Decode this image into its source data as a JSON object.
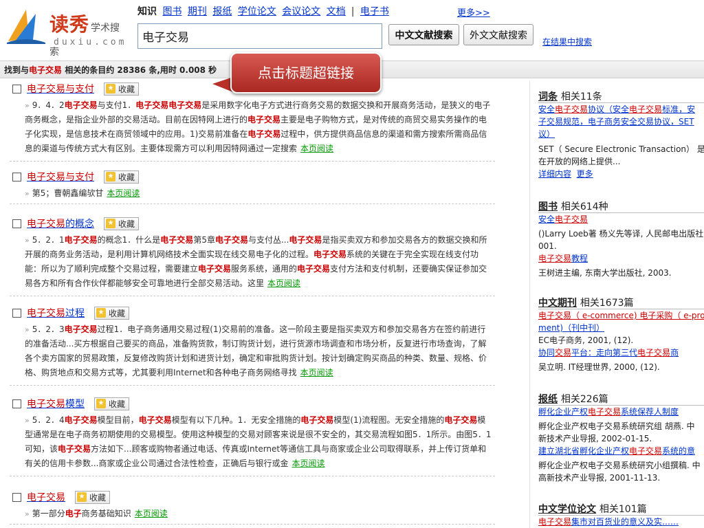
{
  "header": {
    "logo": {
      "brand_cn": "读秀",
      "brand_sub": "学术搜索",
      "brand_en": "duxiu.com"
    },
    "nav": {
      "lead": "知识",
      "items": [
        "图书",
        "期刊",
        "报纸",
        "学位论文",
        "会议论文",
        "文档"
      ],
      "sep": "|",
      "last": "电子书",
      "more": "更多>>"
    },
    "search": {
      "value": "电子交易",
      "btn_cn": "中文文献搜索",
      "btn_foreign": "外文文献搜索",
      "in_results": "在结果中搜索"
    }
  },
  "result_bar": {
    "pre": "找到与",
    "keyword": "电子交易",
    "mid": " 相关的条目约 28386 条,用时 0.008 秒"
  },
  "callout": {
    "text": "点击标题超链接"
  },
  "fav_label": "收藏",
  "read_label": "本页阅读",
  "results": [
    {
      "title_hl": "电子交易与支付",
      "title_rest": "",
      "snippet_html": "9．4．2<b class=\"hl\">电子交易</b>与支付1．<b class=\"hl\">电子交易电子交易</b>是采用数字化电子方式进行商务交易的数据交换和开展商务活动，是狭义的电子商务概念，是指企业外部的交易活动。目前在因特网上进行的<b class=\"hl\">电子交易</b>主要是电子购物方式，是对传统的商贸交易实务操作的电子化实现，是信息技术在商贸领域中的应用。1)交易前准备在<b class=\"hl\">电子交易</b>过程中，供方提供商品信息的渠道和需方搜索所需商品信息的渠道与传统方式大有区别。主要体现需方可以利用因特网通过一定搜索"
    },
    {
      "title_hl": "电子交易与支付",
      "title_rest": "",
      "snippet_html": "第5；曹朝鑫编欤甘"
    },
    {
      "title_hl": "电子交易",
      "title_rest": "的概念",
      "snippet_html": "5．2．1<b class=\"hl\">电子交易</b>的概念1．什么是<b class=\"hl\">电子交易</b>第5章<b class=\"hl\">电子交易</b>与支付丛...<b class=\"hl\">电子交易</b>是指买卖双方和参加交易各方的数据交换和所开展的商务业务活动，是利用计算机网络技术全面实现在线交易电子化的过程。<b class=\"hl\">电子交易</b>系统的关键在于完全实现在线支付功能：所以为了顺利完成整个交易过程，需要建立<b class=\"hl\">电子交易</b>服务系统，通用的<b class=\"hl\">电子交易</b>支付方法和支付机制，还要确实保证参加交易各方和所有合作伙伴都能够安全可靠地进行全部交易活动。这里"
    },
    {
      "title_hl": "电子交易",
      "title_rest": "过程",
      "snippet_html": "5．2．3<b class=\"hl\">电子交易</b>过程1．电子商务通用交易过程(1)交易前的准备。这一阶段主要是指买卖双方和参加交易各方在签约前进行的准备活动...买方根据自己要买的商品，准备购货款，制订购货计划，进行货源市场调查和市场分析，反复进行市场查询，了解各个卖方国家的贸易政策，反复修改购货计划和进货计划，确定和审批购货计划。按计划确定购买商品的种类、数量、规格、价格、购货地点和交易方式等，尤其要利用Internet和各种电子商务网络寻找"
    },
    {
      "title_hl": "电子交易",
      "title_rest": "模型",
      "snippet_html": "5．2．4<b class=\"hl\">电子交易</b>模型目前，<b class=\"hl\">电子交易</b>模型有以下几种。1．无安全措施的<b class=\"hl\">电子交易</b>模型(1)流程图。无安全措施的<b class=\"hl\">电子交易</b>模型通常是在电子商务初期使用的交易模型。使用这种模型的交易对顾客来说是很不安全的，其交易流程如图5．1所示。由图5．1可知，该<b class=\"hl\">电子交易</b>方法如下...顾客或购物者通过电话、传真或Internet等通信工具与商家或企业公司取得联系，并上传订货单和有关的信用卡参数...商家或企业公司通过合法性检查，正确后与银行或金"
    },
    {
      "title_hl": "电子交易",
      "title_rest": "",
      "snippet_html": "第一部分<b class=\"hl\">电子</b>商务基础知识"
    }
  ],
  "sidebar": {
    "ci": {
      "title": "词条",
      "count": "相关11条",
      "lines_html": [
        "<span class=\"lnk\">安全</span><span class=\"red\">电子交易</span><span class=\"lnk\">协议（安全</span><span class=\"red\">电子交易</span><span class=\"lnk\">标准，安</span>",
        "<span class=\"lnk\">子交易规范，电子商务安全交易协议，SET</span>",
        "<span class=\"lnk\">议）</span>"
      ],
      "desc1": "SET（ Secure Electronic Transaction） 是",
      "desc2": "在开放的网络上提供...",
      "detail": "详细内容",
      "more": "更多"
    },
    "book": {
      "title": "图书",
      "count": "相关614种",
      "items": [
        {
          "t1": "安全",
          "t2": "电子交易",
          "meta1": "()Larry Loeb著 杨义先等译, 人民邮电出版社",
          "meta2": "001."
        },
        {
          "t1": "",
          "t2": "电子交易",
          "t3": "教程",
          "meta1": "王树进主编, 东南大学出版社, 2003."
        }
      ]
    },
    "journal": {
      "title": "中文期刊",
      "count": "相关1673篇",
      "item1_l1": "电子交易（ e-commerce) 电子采购（ e-proc",
      "item1_l2": "ment)（刊中刊）",
      "item1_meta": "EC电子商务, 2001, (12).",
      "item2_t1": "协同",
      "item2_t2": "交易",
      "item2_t3": "平台：走向第三代",
      "item2_t4": "电子交易",
      "item2_t5": "商",
      "item2_meta": "吴立明. IT经理世界, 2000, (12)."
    },
    "paper": {
      "title": "报纸",
      "count": "相关226篇",
      "item1_t1": "孵化企业产权",
      "item1_t2": "电子交易",
      "item1_t3": "系统保荐人制度",
      "item1_meta1": "孵化企业产权电子交易系统研究组 胡燕. 中",
      "item1_meta2": "新技术产业导报, 2002-01-15.",
      "item2_t1": "建立湖北省孵化企业产权",
      "item2_t2": "电子交易",
      "item2_t3": "系统的意",
      "item2_meta1": "孵化企业产权电子交易系统研究小组撰稿. 中",
      "item2_meta2": "高新技术产业导报, 2001-11-13."
    },
    "thesis": {
      "title": "中文学位论文",
      "count": "相关101篇",
      "item1_t1": "电子交易",
      "item1_t2": "集市对百货业的意义及实……"
    }
  },
  "colors": {
    "link": "#0033cc",
    "highlight": "#cc0000",
    "read": "#009900",
    "callout": "#b73029"
  }
}
